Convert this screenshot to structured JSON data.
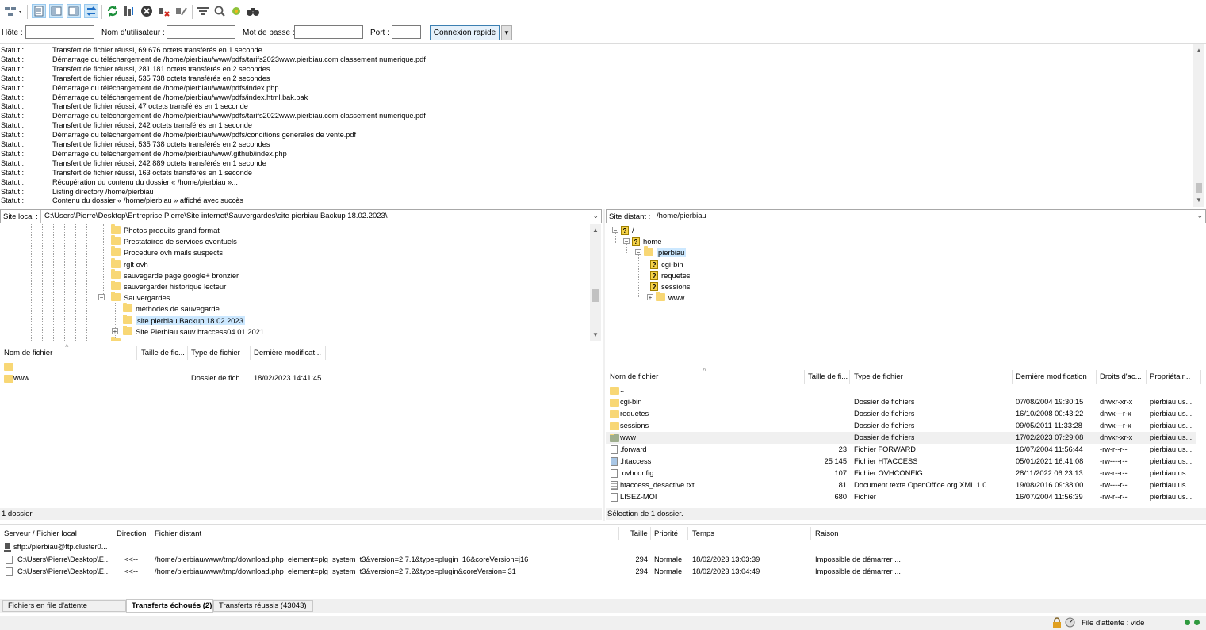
{
  "toolbar": {
    "buttons": [
      "site-manager",
      "toggle-message-log",
      "toggle-local-tree",
      "toggle-remote-tree",
      "toggle-queue",
      "refresh",
      "process-queue",
      "cancel",
      "disconnect",
      "reconnect",
      "directory-filter",
      "toggle-sync-browsing",
      "synchronized-browsing",
      "search-remote-files"
    ]
  },
  "quickconnect": {
    "host_label": "Hôte :",
    "user_label": "Nom d'utilisateur :",
    "pass_label": "Mot de passe :",
    "port_label": "Port :",
    "connect_label": "Connexion rapide",
    "host_value": "",
    "user_value": "",
    "pass_value": "",
    "port_value": ""
  },
  "log": [
    {
      "k": "Statut :",
      "v": "Transfert de fichier réussi, 69 676 octets transférés en 1 seconde"
    },
    {
      "k": "Statut :",
      "v": "Démarrage du téléchargement de /home/pierbiau/www/pdfs/tarifs2023www.pierbiau.com classement numerique.pdf"
    },
    {
      "k": "Statut :",
      "v": "Transfert de fichier réussi, 281 181 octets transférés en 2 secondes"
    },
    {
      "k": "Statut :",
      "v": "Transfert de fichier réussi, 535 738 octets transférés en 2 secondes"
    },
    {
      "k": "Statut :",
      "v": "Démarrage du téléchargement de /home/pierbiau/www/pdfs/index.php"
    },
    {
      "k": "Statut :",
      "v": "Démarrage du téléchargement de /home/pierbiau/www/pdfs/index.html.bak.bak"
    },
    {
      "k": "Statut :",
      "v": "Transfert de fichier réussi, 47 octets transférés en 1 seconde"
    },
    {
      "k": "Statut :",
      "v": "Démarrage du téléchargement de /home/pierbiau/www/pdfs/tarifs2022www.pierbiau.com classement numerique.pdf"
    },
    {
      "k": "Statut :",
      "v": "Transfert de fichier réussi, 242 octets transférés en 1 seconde"
    },
    {
      "k": "Statut :",
      "v": "Démarrage du téléchargement de /home/pierbiau/www/pdfs/conditions generales de vente.pdf"
    },
    {
      "k": "Statut :",
      "v": "Transfert de fichier réussi, 535 738 octets transférés en 2 secondes"
    },
    {
      "k": "Statut :",
      "v": "Démarrage du téléchargement de /home/pierbiau/www/.github/index.php"
    },
    {
      "k": "Statut :",
      "v": "Transfert de fichier réussi, 242 889 octets transférés en 1 seconde"
    },
    {
      "k": "Statut :",
      "v": "Transfert de fichier réussi, 163 octets transférés en 1 seconde"
    },
    {
      "k": "Statut :",
      "v": "Récupération du contenu du dossier « /home/pierbiau »..."
    },
    {
      "k": "Statut :",
      "v": "Listing directory /home/pierbiau"
    },
    {
      "k": "Statut :",
      "v": "Contenu du dossier « /home/pierbiau » affiché avec succès"
    }
  ],
  "local": {
    "site_label": "Site local :",
    "path": "C:\\Users\\Pierre\\Desktop\\Entreprise Pierre\\Site internet\\Sauvergardes\\site pierbiau Backup 18.02.2023\\",
    "tree": [
      "Photos produits grand format",
      "Prestataires de services eventuels",
      "Procedure ovh mails suspects",
      "rglt ovh",
      "sauvegarde page google+ bronzier",
      "sauvergarder historique lecteur",
      "Sauvergardes",
      "methodes de sauvegarde",
      "site pierbiau Backup 18.02.2023",
      "Site Pierbiau sauv htaccess04.01.2021"
    ],
    "columns": [
      "Nom de fichier",
      "Taille de fic...",
      "Type de fichier",
      "Dernière modificat..."
    ],
    "files": [
      {
        "name": "..",
        "size": "",
        "type": "",
        "date": ""
      },
      {
        "name": "www",
        "size": "",
        "type": "Dossier de fich...",
        "date": "18/02/2023 14:41:45"
      }
    ],
    "status": "1 dossier"
  },
  "remote": {
    "site_label": "Site distant :",
    "path": "/home/pierbiau",
    "tree": [
      "/",
      "home",
      "pierbiau",
      "cgi-bin",
      "requetes",
      "sessions",
      "www"
    ],
    "columns": [
      "Nom de fichier",
      "Taille de fi...",
      "Type de fichier",
      "Dernière modification",
      "Droits d'ac...",
      "Propriétair..."
    ],
    "files": [
      {
        "name": "..",
        "size": "",
        "type": "",
        "date": "",
        "perm": "",
        "owner": "",
        "icon": "folder"
      },
      {
        "name": "cgi-bin",
        "size": "",
        "type": "Dossier de fichiers",
        "date": "07/08/2004 19:30:15",
        "perm": "drwxr-xr-x",
        "owner": "pierbiau us...",
        "icon": "folder"
      },
      {
        "name": "requetes",
        "size": "",
        "type": "Dossier de fichiers",
        "date": "16/10/2008 00:43:22",
        "perm": "drwx---r-x",
        "owner": "pierbiau us...",
        "icon": "folder"
      },
      {
        "name": "sessions",
        "size": "",
        "type": "Dossier de fichiers",
        "date": "09/05/2011 11:33:28",
        "perm": "drwx---r-x",
        "owner": "pierbiau us...",
        "icon": "folder"
      },
      {
        "name": "www",
        "size": "",
        "type": "Dossier de fichiers",
        "date": "17/02/2023 07:29:08",
        "perm": "drwxr-xr-x",
        "owner": "pierbiau us...",
        "icon": "folder-selected"
      },
      {
        "name": ".forward",
        "size": "23",
        "type": "Fichier FORWARD",
        "date": "16/07/2004 11:56:44",
        "perm": "-rw-r--r--",
        "owner": "pierbiau us...",
        "icon": "file"
      },
      {
        "name": ".htaccess",
        "size": "25 145",
        "type": "Fichier HTACCESS",
        "date": "05/01/2021 16:41:08",
        "perm": "-rw----r--",
        "owner": "pierbiau us...",
        "icon": "file-blue"
      },
      {
        "name": ".ovhconfig",
        "size": "107",
        "type": "Fichier OVHCONFIG",
        "date": "28/11/2022 06:23:13",
        "perm": "-rw-r--r--",
        "owner": "pierbiau us...",
        "icon": "file"
      },
      {
        "name": "htaccess_desactive.txt",
        "size": "81",
        "type": "Document texte OpenOffice.org XML 1.0",
        "date": "19/08/2016 09:38:00",
        "perm": "-rw----r--",
        "owner": "pierbiau us...",
        "icon": "file-text"
      },
      {
        "name": "LISEZ-MOI",
        "size": "680",
        "type": "Fichier",
        "date": "16/07/2004 11:56:39",
        "perm": "-rw-r--r--",
        "owner": "pierbiau us...",
        "icon": "file"
      }
    ],
    "status": "Sélection de 1 dossier."
  },
  "queue": {
    "columns": [
      "Serveur / Fichier local",
      "Direction",
      "Fichier distant",
      "Taille",
      "Priorité",
      "Temps",
      "Raison"
    ],
    "server": "sftp://pierbiau@ftp.cluster0...",
    "rows": [
      {
        "local": "C:\\Users\\Pierre\\Desktop\\E...",
        "dir": "<<--",
        "remote": "/home/pierbiau/www/tmp/download.php_element=plg_system_t3&version=2.7.1&type=plugin_16&coreVersion=j16",
        "size": "294",
        "prio": "Normale",
        "time": "18/02/2023 13:03:39",
        "reason": "Impossible de démarrer ..."
      },
      {
        "local": "C:\\Users\\Pierre\\Desktop\\E...",
        "dir": "<<--",
        "remote": "/home/pierbiau/www/tmp/download.php_element=plg_system_t3&version=2.7.2&type=plugin&coreVersion=j31",
        "size": "294",
        "prio": "Normale",
        "time": "18/02/2023 13:04:49",
        "reason": "Impossible de démarrer ..."
      }
    ]
  },
  "tabs": [
    "Fichiers en file d'attente",
    "Transferts échoués (2)",
    "Transferts réussis (43043)"
  ],
  "statusbar": {
    "queue": "File d'attente : vide"
  },
  "colors": {
    "folder": "#f8d775",
    "selection": "#cce8ff",
    "button_border": "#3c7fb1"
  }
}
